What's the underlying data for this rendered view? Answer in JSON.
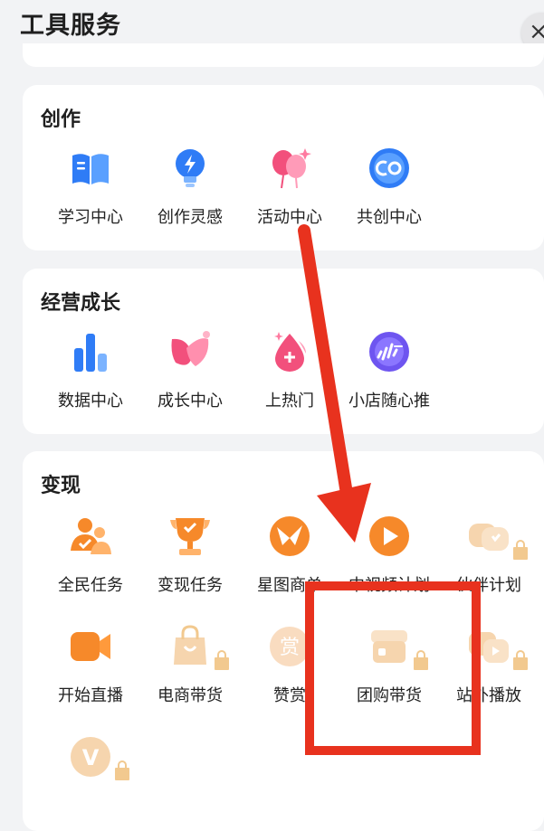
{
  "header": {
    "title": "工具服务",
    "close_label": "×"
  },
  "sections": [
    {
      "title": "创作",
      "items": [
        {
          "label": "学习中心",
          "icon": "book-icon"
        },
        {
          "label": "创作灵感",
          "icon": "lightbulb-icon"
        },
        {
          "label": "活动中心",
          "icon": "balloon-icon"
        },
        {
          "label": "共创中心",
          "icon": "co-circle-icon"
        }
      ]
    },
    {
      "title": "经营成长",
      "items": [
        {
          "label": "数据中心",
          "icon": "bar-chart-icon"
        },
        {
          "label": "成长中心",
          "icon": "petal-icon"
        },
        {
          "label": "上热门",
          "icon": "hot-drop-icon"
        },
        {
          "label": "小店随心推",
          "icon": "signal-icon"
        }
      ]
    },
    {
      "title": "变现",
      "items": [
        {
          "label": "全民任务",
          "icon": "people-icon"
        },
        {
          "label": "变现任务",
          "icon": "trophy-icon"
        },
        {
          "label": "星图商单",
          "icon": "star-map-icon"
        },
        {
          "label": "中视频计划",
          "icon": "video-play-icon"
        },
        {
          "label": "伙伴计划",
          "icon": "partner-icon"
        },
        {
          "label": "开始直播",
          "icon": "camera-icon"
        },
        {
          "label": "电商带货",
          "icon": "shopping-bag-icon"
        },
        {
          "label": "赞赏",
          "icon": "reward-icon",
          "glyph": "赏"
        },
        {
          "label": "团购带货",
          "icon": "group-buy-icon"
        },
        {
          "label": "站外播放",
          "icon": "external-play-icon"
        },
        {
          "label": "",
          "icon": "v-badge-icon",
          "glyph": "V"
        }
      ]
    }
  ],
  "colors": {
    "annotation_red": "#e8321e",
    "blue": "#2f7cf6",
    "orange": "#f6892a",
    "pink": "#f2507c"
  }
}
